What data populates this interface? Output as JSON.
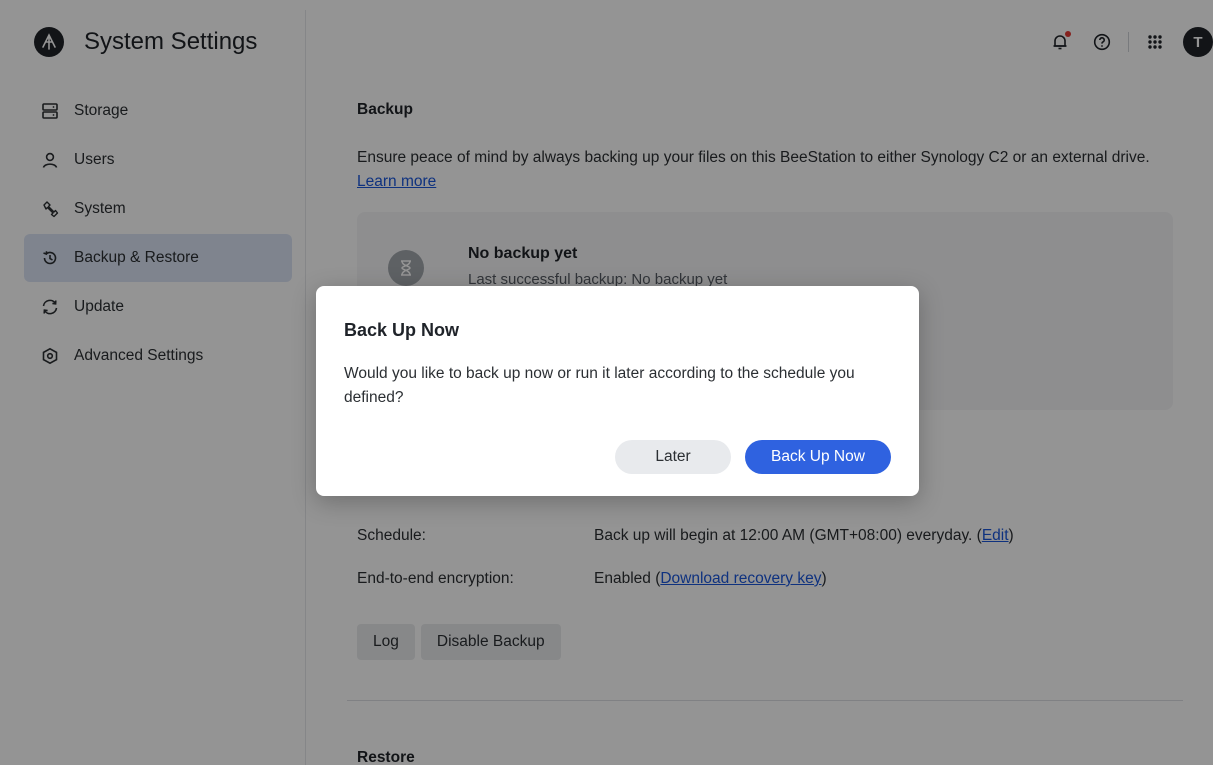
{
  "app": {
    "title": "System Settings"
  },
  "sidebar": {
    "items": [
      {
        "label": "Storage",
        "icon": "storage-icon"
      },
      {
        "label": "Users",
        "icon": "user-icon"
      },
      {
        "label": "System",
        "icon": "wrench-icon"
      },
      {
        "label": "Backup & Restore",
        "icon": "backup-restore-icon",
        "active": true
      },
      {
        "label": "Update",
        "icon": "update-icon"
      },
      {
        "label": "Advanced Settings",
        "icon": "advanced-settings-icon"
      }
    ]
  },
  "topbar": {
    "icons": [
      "notification-bell-icon",
      "help-icon",
      "apps-grid-icon"
    ],
    "avatar_initial": "T",
    "notification_dot_color": "#e53935"
  },
  "backup": {
    "title": "Backup",
    "description": "Ensure peace of mind by always backing up your files on this BeeStation to either Synology C2 or an external drive.",
    "learn_more": "Learn more",
    "status": {
      "title": "No backup yet",
      "subtitle": "Last successful backup: No backup yet"
    },
    "schedule_label": "Schedule:",
    "schedule_value": "Back up will begin at 12:00 AM (GMT+08:00) everyday.",
    "schedule_edit": "Edit",
    "encryption_label": "End-to-end encryption:",
    "encryption_value": "Enabled",
    "encryption_link": "Download recovery key",
    "log_button": "Log",
    "disable_button": "Disable Backup"
  },
  "restore": {
    "title": "Restore"
  },
  "modal": {
    "title": "Back Up Now",
    "body": "Would you like to back up now or run it later according to the schedule you defined?",
    "later_button": "Later",
    "confirm_button": "Back Up Now"
  },
  "colors": {
    "accent": "#2f62e0",
    "active_nav_bg": "#dbe4f5",
    "link": "#1a56db"
  }
}
